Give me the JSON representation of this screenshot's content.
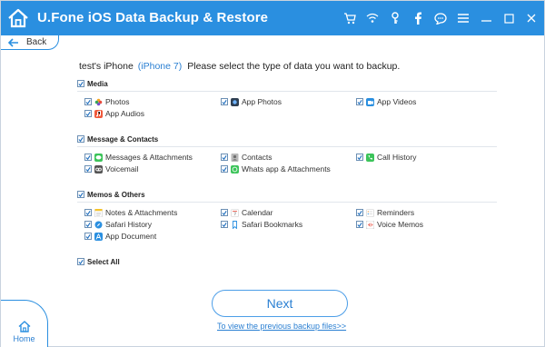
{
  "app": {
    "title": "U.Fone iOS Data Backup & Restore"
  },
  "titlebar_icons": [
    "cart-icon",
    "wifi-icon",
    "key-icon",
    "facebook-icon",
    "chat-icon",
    "menu-icon",
    "minimize-icon",
    "restore-icon",
    "close-icon"
  ],
  "nav": {
    "back_label": "Back",
    "home_label": "Home"
  },
  "headline": {
    "device_name": "test's iPhone",
    "device_model": "(iPhone 7)",
    "instruction": "Please select the type of data you want to backup."
  },
  "sections": {
    "media": {
      "label": "Media",
      "items": [
        "Photos",
        "App Photos",
        "App Videos",
        "App Audios"
      ]
    },
    "message": {
      "label": "Message & Contacts",
      "items": [
        "Messages & Attachments",
        "Contacts",
        "Call History",
        "Voicemail",
        "Whats app & Attachments"
      ]
    },
    "memos": {
      "label": "Memos & Others",
      "items": [
        "Notes & Attachments",
        "Calendar",
        "Reminders",
        "Safari History",
        "Safari Bookmarks",
        "Voice Memos",
        "App Document"
      ]
    }
  },
  "select_all_label": "Select All",
  "next_label": "Next",
  "previous_link": "To view the previous backup files>>",
  "colors": {
    "accent": "#2a8fe0",
    "link": "#2a7fd2"
  }
}
